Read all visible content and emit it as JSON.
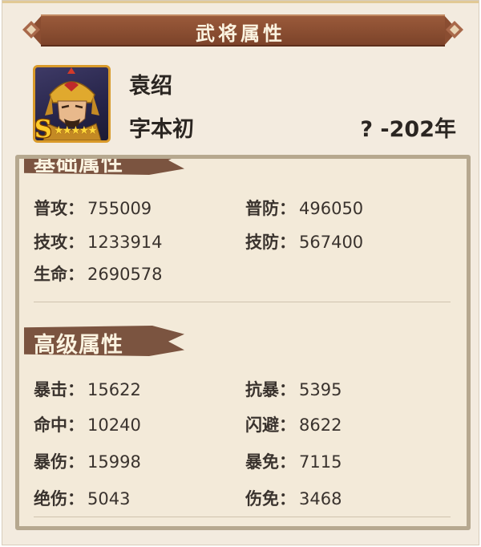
{
  "title": "武将属性",
  "hero": {
    "name": "袁绍",
    "courtesy_name": "字本初",
    "years": "? -202年",
    "rank": "S",
    "stars": "★★★★★"
  },
  "basic": {
    "title": "基础属性",
    "stats": [
      {
        "label": "普攻：",
        "value": "755009"
      },
      {
        "label": "普防：",
        "value": "496050"
      },
      {
        "label": "技攻：",
        "value": "1233914"
      },
      {
        "label": "技防：",
        "value": "567400"
      },
      {
        "label": "生命：",
        "value": "2690578"
      }
    ]
  },
  "advanced": {
    "title": "高级属性",
    "stats": [
      {
        "label": "暴击：",
        "value": "15622"
      },
      {
        "label": "抗暴：",
        "value": "5395"
      },
      {
        "label": "命中：",
        "value": "10240"
      },
      {
        "label": "闪避：",
        "value": "8622"
      },
      {
        "label": "暴伤：",
        "value": "15998"
      },
      {
        "label": "暴免：",
        "value": "7115"
      },
      {
        "label": "绝伤：",
        "value": "5043"
      },
      {
        "label": "伤免：",
        "value": "3468"
      }
    ]
  },
  "colors": {
    "banner": "#8a4d31",
    "section_tab": "#7b5440",
    "panel_bg": "#f3ebdf",
    "text": "#3a332e"
  },
  "icons": [
    "diamond-ornament-icon",
    "hero-portrait",
    "star-icon"
  ]
}
